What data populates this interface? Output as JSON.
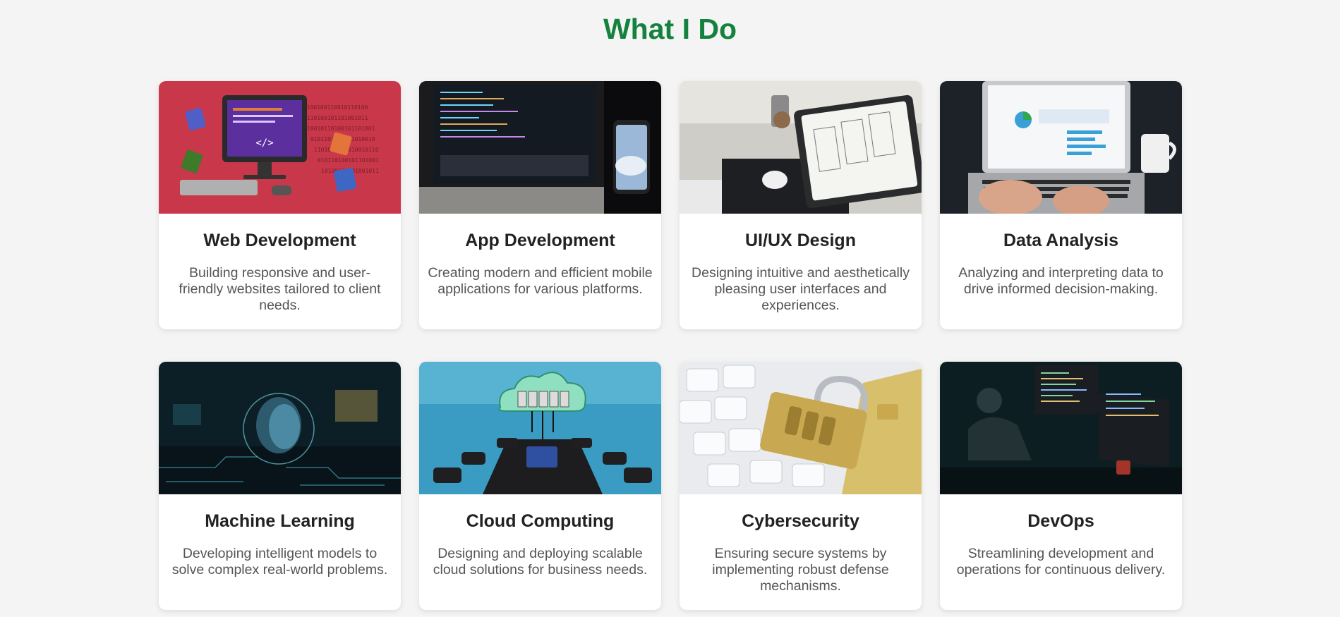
{
  "section_title": "What I Do",
  "services": [
    {
      "title": "Web Development",
      "description": "Building responsive and user-friendly websites tailored to client needs.",
      "image": "web-development-image"
    },
    {
      "title": "App Development",
      "description": "Creating modern and efficient mobile applications for various platforms.",
      "image": "app-development-image"
    },
    {
      "title": "UI/UX Design",
      "description": "Designing intuitive and aesthetically pleasing user interfaces and experiences.",
      "image": "ui-ux-design-image"
    },
    {
      "title": "Data Analysis",
      "description": "Analyzing and interpreting data to drive informed decision-making.",
      "image": "data-analysis-image"
    },
    {
      "title": "Machine Learning",
      "description": "Developing intelligent models to solve complex real-world problems.",
      "image": "machine-learning-image"
    },
    {
      "title": "Cloud Computing",
      "description": "Designing and deploying scalable cloud solutions for business needs.",
      "image": "cloud-computing-image"
    },
    {
      "title": "Cybersecurity",
      "description": "Ensuring secure systems by implementing robust defense mechanisms.",
      "image": "cybersecurity-image"
    },
    {
      "title": "DevOps",
      "description": "Streamlining development and operations for continuous delivery.",
      "image": "devops-image"
    }
  ],
  "colors": {
    "title": "#14813f",
    "background": "#f4f4f4",
    "card": "#ffffff"
  }
}
